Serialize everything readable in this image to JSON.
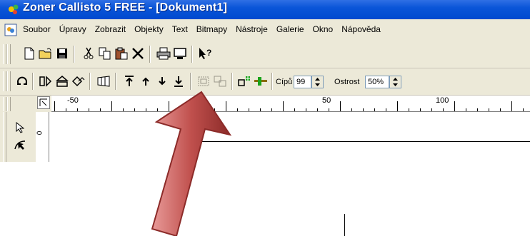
{
  "window": {
    "title": "Zoner Callisto 5 FREE - [Dokument1]"
  },
  "menubar": {
    "items": [
      "Soubor",
      "Úpravy",
      "Zobrazit",
      "Objekty",
      "Text",
      "Bitmapy",
      "Nástroje",
      "Galerie",
      "Okno",
      "Nápověda"
    ]
  },
  "toolbar_standard": {
    "buttons": [
      "new-document-icon",
      "open-folder-icon",
      "save-icon",
      "cut-icon",
      "copy-icon",
      "paste-icon",
      "delete-icon",
      "print-icon",
      "preview-icon",
      "context-help-icon"
    ]
  },
  "toolbar_objects": {
    "cip_label": "Cípů",
    "cip_value": "99",
    "ostrost_label": "Ostrost",
    "ostrost_value": "50%"
  },
  "ruler": {
    "labels": [
      "-50",
      "50",
      "100"
    ]
  },
  "colors": {
    "titlebar": "#0a55d8",
    "chrome": "#ece9d8",
    "arrow_fill": "#c0504d"
  }
}
